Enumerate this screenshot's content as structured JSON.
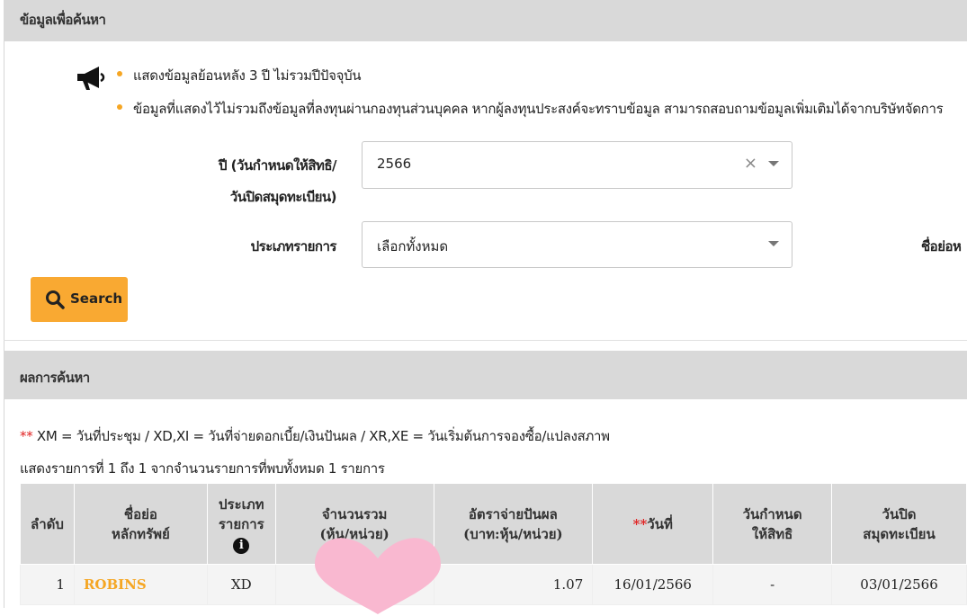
{
  "search_section": {
    "title": "ข้อมูลเพื่อค้นหา"
  },
  "notices": [
    "แสดงข้อมูลย้อนหลัง 3 ปี ไม่รวมปีปัจจุบัน",
    "ข้อมูลที่แสดงไว้ไม่รวมถึงข้อมูลที่ลงทุนผ่านกองทุนส่วนบุคคล หากผู้ลงทุนประสงค์จะทราบข้อมูล สามารถสอบถามข้อมูลเพิ่มเติมได้จากบริษัทจัดการ"
  ],
  "form": {
    "year_label_line1": "ปี (วันกำหนดให้สิทธิ/",
    "year_label_line2": "วันปิดสมุดทะเบียน)",
    "year_value": "2566",
    "type_label": "ประเภทรายการ",
    "type_value": "เลือกทั้งหมด",
    "short_name_label": "ชื่อย่อห",
    "search_label": "Search"
  },
  "results_section": {
    "title": "ผลการค้นหา"
  },
  "note": {
    "star": "**",
    "text": " XM = วันที่ประชุม / XD,XI = วันที่จ่ายดอกเบี้ย/เงินปันผล / XR,XE = วันเริ่มต้นการจองซื้อ/แปลงสภาพ"
  },
  "count_text": "แสดงรายการที่ 1 ถึง 1 จากจำนวนรายการที่พบทั้งหมด 1 รายการ",
  "table": {
    "headers": {
      "no": "ลำดับ",
      "symbol_l1": "ชื่อย่อ",
      "symbol_l2": "หลักทรัพย์",
      "type_l1": "ประเภท",
      "type_l2": "รายการ",
      "total_l1": "จำนวนรวม",
      "total_l2": "(หุ้น/หน่วย)",
      "rate_l1": "อัตราจ่ายปันผล",
      "rate_l2": "(บาท:หุ้น/หน่วย)",
      "date_star": "**",
      "date": "วันที่",
      "record_l1": "วันกำหนด",
      "record_l2": "ให้สิทธิ",
      "book_l1": "วันปิด",
      "book_l2": "สมุดทะเบียน"
    },
    "rows": [
      {
        "no": "1",
        "symbol": "ROBINS",
        "type": "XD",
        "total": "",
        "rate": "1.07",
        "date": "16/01/2566",
        "record": "-",
        "book": "03/01/2566"
      }
    ]
  },
  "colors": {
    "accent": "#f9a932",
    "header_bg": "#d9d9d9",
    "star_red": "#e02020",
    "heart_pink": "#f9b8d0"
  },
  "icons": {
    "announce": "megaphone-icon",
    "search": "magnifier-icon",
    "info": "info-circle-icon",
    "clear": "close-icon",
    "dropdown": "caret-down-icon",
    "redaction": "heart-sticker"
  }
}
